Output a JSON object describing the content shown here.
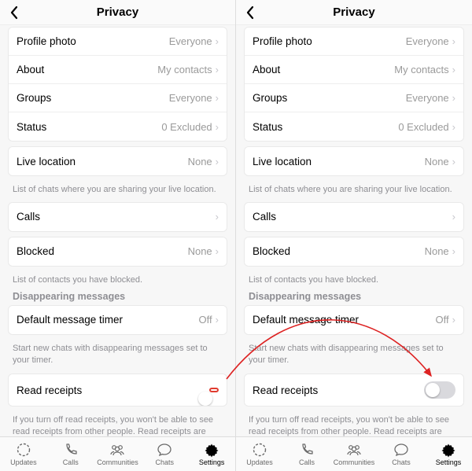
{
  "header": {
    "title": "Privacy"
  },
  "rows": {
    "profile_photo": {
      "label": "Profile photo",
      "value": "Everyone"
    },
    "about": {
      "label": "About",
      "value": "My contacts"
    },
    "groups": {
      "label": "Groups",
      "value": "Everyone"
    },
    "status": {
      "label": "Status",
      "value": "0 Excluded"
    },
    "live_location": {
      "label": "Live location",
      "value": "None"
    },
    "calls": {
      "label": "Calls",
      "value": ""
    },
    "blocked": {
      "label": "Blocked",
      "value": "None"
    },
    "default_timer": {
      "label": "Default message timer",
      "value": "Off"
    },
    "read_receipts": {
      "label": "Read receipts"
    }
  },
  "footnotes": {
    "live_location": "List of chats where you are sharing your live location.",
    "blocked": "List of contacts you have blocked.",
    "disappearing": "Start new chats with disappearing messages set to your timer.",
    "read_receipts": "If you turn off read receipts, you won't be able to see read receipts from other people. Read receipts are always sent for group chats."
  },
  "sections": {
    "disappearing": "Disappearing messages"
  },
  "tabs": {
    "updates": "Updates",
    "calls": "Calls",
    "communities": "Communities",
    "chats": "Chats",
    "settings": "Settings"
  },
  "left": {
    "read_receipts_on": true
  },
  "right": {
    "read_receipts_on": false
  }
}
